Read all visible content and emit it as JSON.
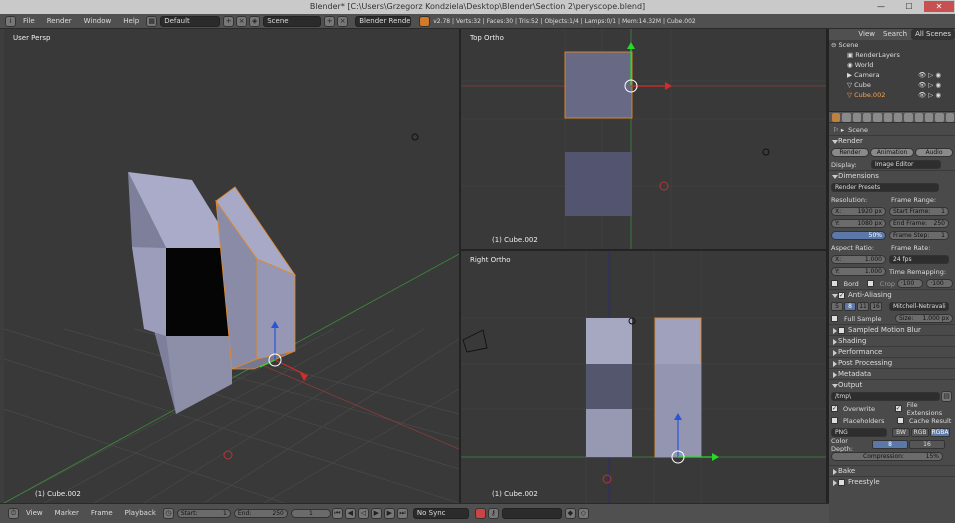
{
  "window": {
    "title": "Blender* [C:\\Users\\Grzegorz Kondziela\\Desktop\\Blender\\Section 2\\peryscope.blend]",
    "minimize": "—",
    "maximize": "☐",
    "close": "✕"
  },
  "menu": {
    "items": [
      "File",
      "Render",
      "Window",
      "Help"
    ],
    "layout": "Default",
    "scene": "Scene",
    "engine": "Blender Render",
    "stats": "v2.78 | Verts:32 | Faces:30 | Tris:52 | Objects:1/4 | Lamps:0/1 | Mem:14.32M | Cube.002"
  },
  "viewports": {
    "persp": {
      "label": "User Persp",
      "object": "(1) Cube.002"
    },
    "top": {
      "label": "Top Ortho",
      "object": "(1) Cube.002"
    },
    "right": {
      "label": "Right Ortho",
      "object": "(1) Cube.002"
    }
  },
  "timeline": {
    "view": "View",
    "marker": "Marker",
    "frame": "Frame",
    "playback": "Playback",
    "start_label": "Start:",
    "start": "1",
    "end_label": "End:",
    "end": "250",
    "current": "1",
    "sync": "No Sync"
  },
  "outliner": {
    "tabs": [
      "View",
      "Search",
      "All Scenes"
    ],
    "items": [
      "Scene",
      "RenderLayers",
      "World",
      "Camera",
      "Cube",
      "Cube.002"
    ]
  },
  "properties": {
    "scene_label": "Scene",
    "render_section": "Render",
    "render_btn": "Render",
    "animation_btn": "Animation",
    "audio_btn": "Audio",
    "display_label": "Display:",
    "display_value": "Image Editor",
    "dimensions": "Dimensions",
    "render_presets": "Render Presets",
    "resolution": "Resolution:",
    "res_x": "X:",
    "res_x_val": "1920 px",
    "res_y": "Y:",
    "res_y_val": "1080 px",
    "res_pct": "50%",
    "frame_range": "Frame Range:",
    "start_frame": "Start Frame:",
    "start_frame_val": "1",
    "end_frame": "End Frame:",
    "end_frame_val": "250",
    "frame_step": "Frame Step:",
    "frame_step_val": "1",
    "aspect": "Aspect Ratio:",
    "asp_x": "X:",
    "asp_x_val": "1.000",
    "asp_y": "Y:",
    "asp_y_val": "1.000",
    "frame_rate": "Frame Rate:",
    "fps": "24 fps",
    "time_remap": "Time Remapping:",
    "remap_old": "·100",
    "remap_new": "·100",
    "bord": "Bord",
    "crop": "Crop",
    "anti_aliasing": "Anti-Aliasing",
    "aa_samples": [
      "5",
      "8",
      "11",
      "16"
    ],
    "aa_filter": "Mitchell-Netravali",
    "full_sample": "Full Sample",
    "aa_size": "Size:",
    "aa_size_val": "1.000 px",
    "closed_sections": [
      "Sampled Motion Blur",
      "Shading",
      "Performance",
      "Post Processing",
      "Metadata"
    ],
    "output": "Output",
    "output_path": "/tmp\\",
    "overwrite": "Overwrite",
    "file_ext": "File Extensions",
    "placeholders": "Placeholders",
    "cache_result": "Cache Result",
    "format": "PNG",
    "bw": "BW",
    "rgb": "RGB",
    "rgba": "RGBA",
    "color_depth": "Color Depth:",
    "depth8": "8",
    "depth16": "16",
    "compression": "Compression:",
    "compression_val": "15%",
    "bake": "Bake",
    "freestyle": "Freestyle"
  }
}
